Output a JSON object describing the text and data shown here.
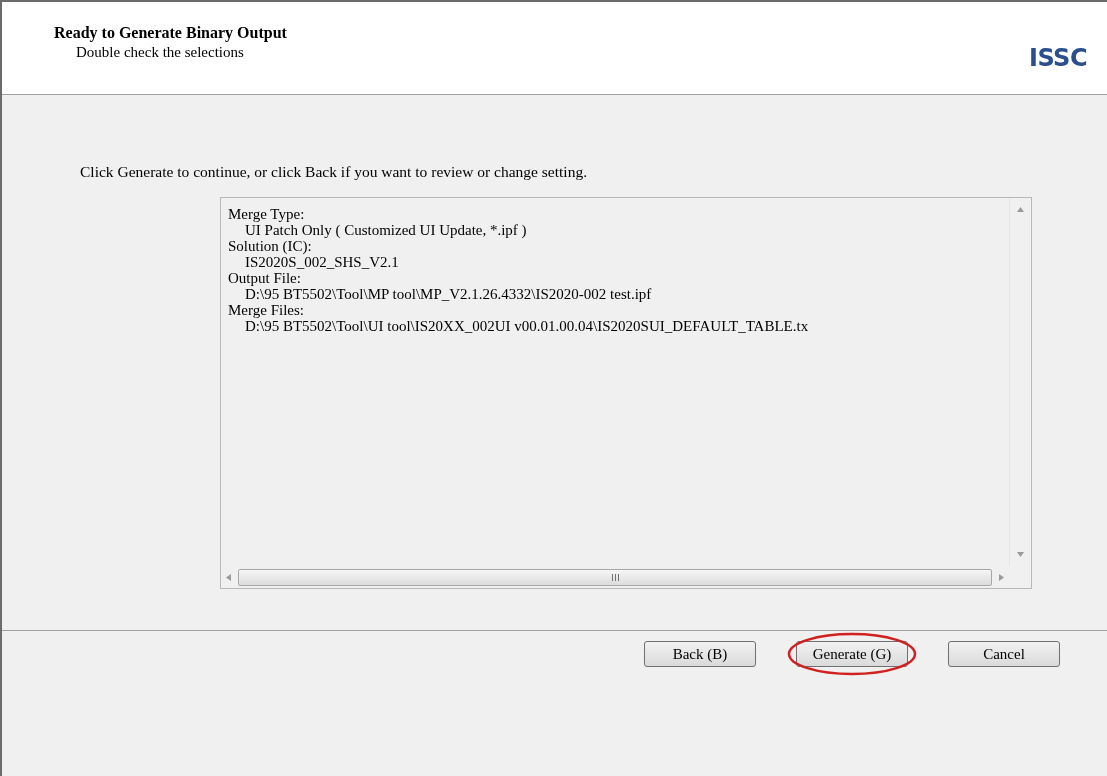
{
  "header": {
    "title": "Ready to Generate Binary Output",
    "subtitle": "Double check the selections",
    "logo": "ISSC"
  },
  "instruction": "Click Generate to continue, or click Back if you want to review or change setting.",
  "summary": [
    {
      "label": "Merge Type:",
      "value": "UI Patch Only ( Customized UI Update, *.ipf )"
    },
    {
      "label": "Solution (IC):",
      "value": "IS2020S_002_SHS_V2.1"
    },
    {
      "label": "Output File:",
      "value": "D:\\95 BT5502\\Tool\\MP tool\\MP_V2.1.26.4332\\IS2020-002 test.ipf"
    },
    {
      "label": "Merge Files:",
      "value": "D:\\95 BT5502\\Tool\\UI tool\\IS20XX_002UI v00.01.00.04\\IS2020SUI_DEFAULT_TABLE.tx"
    }
  ],
  "buttons": [
    {
      "label": "Back (B)",
      "highlighted": false
    },
    {
      "label": "Generate (G)",
      "highlighted": true
    },
    {
      "label": "Cancel",
      "highlighted": false
    }
  ]
}
